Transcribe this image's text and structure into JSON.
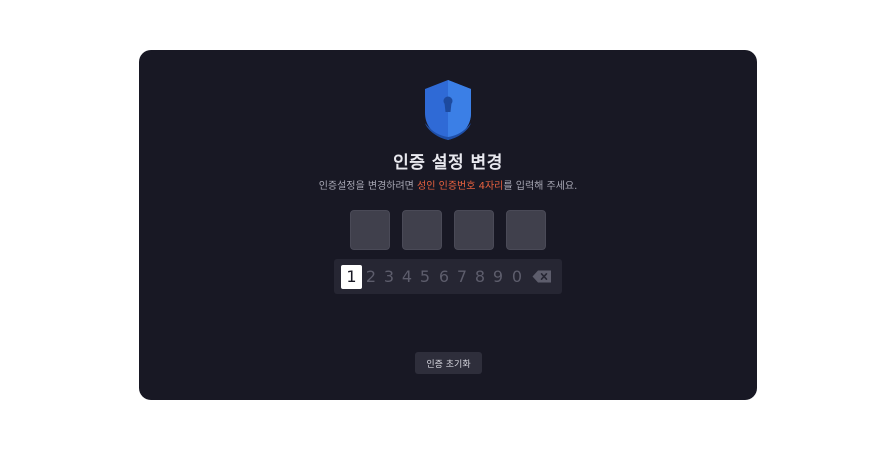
{
  "dialog": {
    "icon": "shield-lock-icon",
    "title": "인증 설정 변경",
    "subtitle": {
      "before": "인증설정을 변경하려면 ",
      "highlight": "성인 인증번호 4자리",
      "after": "를 입력해 주세요."
    },
    "pin_length": 4,
    "keypad": {
      "keys": [
        "1",
        "2",
        "3",
        "4",
        "5",
        "6",
        "7",
        "8",
        "9",
        "0"
      ],
      "active_key": "1",
      "backspace_icon": "backspace-icon"
    },
    "reset_button": "인증 초기화"
  },
  "colors": {
    "background": "#181824",
    "highlight": "#e8613f",
    "shield": "#3b7fe6"
  }
}
